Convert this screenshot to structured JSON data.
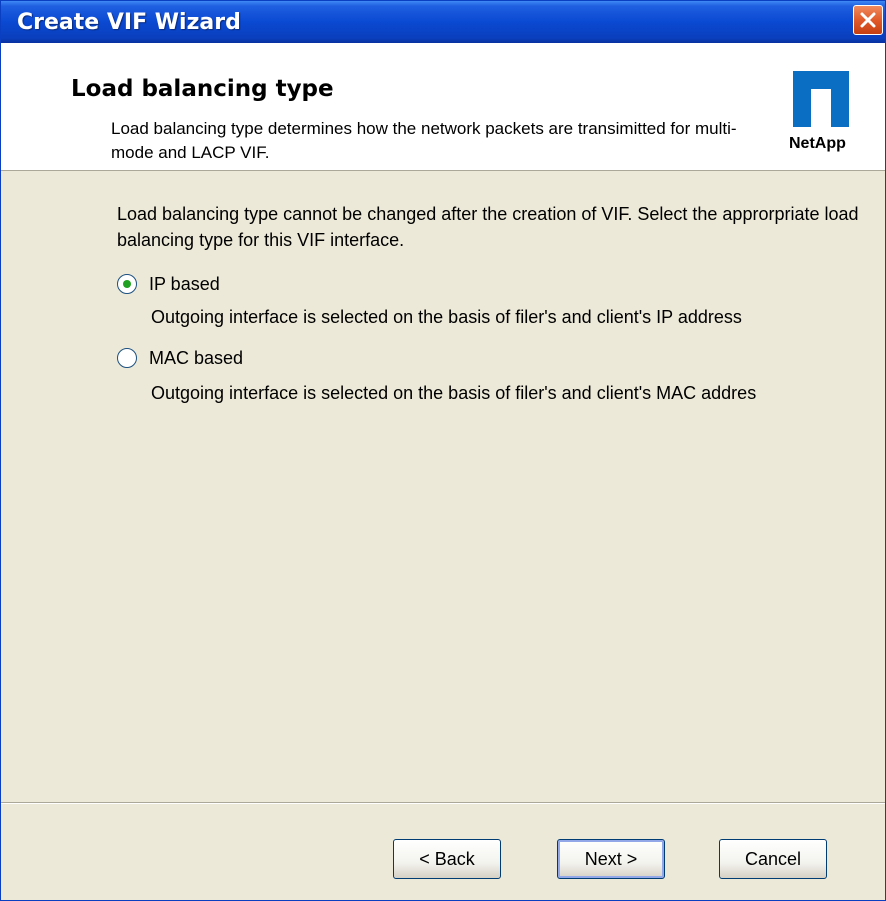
{
  "window": {
    "title": "Create VIF Wizard",
    "close_icon": "close-icon"
  },
  "header": {
    "title": "Load balancing type",
    "description": "Load balancing type determines how the network packets are transimitted for multi-mode and LACP VIF.",
    "logo_text": "NetApp",
    "logo_icon": "netapp-logo-icon"
  },
  "content": {
    "intro": "Load balancing type cannot be changed after the creation of VIF. Select the approrpriate load balancing type for this VIF interface.",
    "options": [
      {
        "label": "IP based",
        "checked": true,
        "description": "Outgoing interface is selected on the basis of filer's and client's IP address"
      },
      {
        "label": "MAC based",
        "checked": false,
        "description": "Outgoing interface is selected on the basis of filer's and client's MAC addres"
      }
    ]
  },
  "buttons": {
    "back": "< Back",
    "next": "Next >",
    "cancel": "Cancel"
  },
  "colors": {
    "titlebar": "#0a49d2",
    "dialog_bg": "#ece9d8",
    "logo_blue": "#0a6fc2",
    "radio_dot": "#21a121"
  }
}
